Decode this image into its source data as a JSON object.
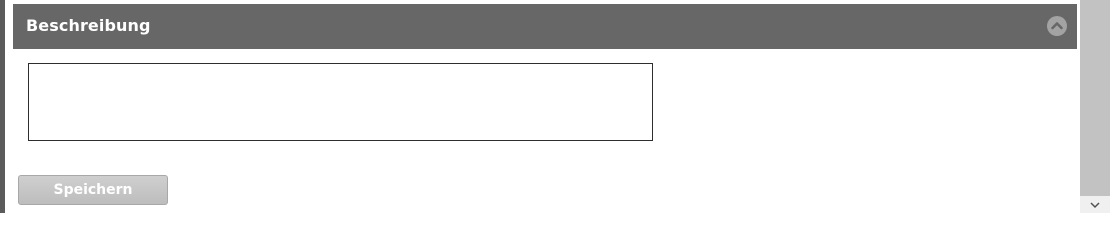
{
  "panel": {
    "title": "Beschreibung",
    "collapse_icon": "chevron-up-icon"
  },
  "description": {
    "value": "",
    "placeholder": ""
  },
  "actions": {
    "save_label": "Speichern",
    "save_enabled": false
  },
  "colors": {
    "header_bg": "#676767",
    "header_text": "#ffffff",
    "button_bg": "#c4c4c4",
    "textarea_border": "#2e2e2e"
  }
}
